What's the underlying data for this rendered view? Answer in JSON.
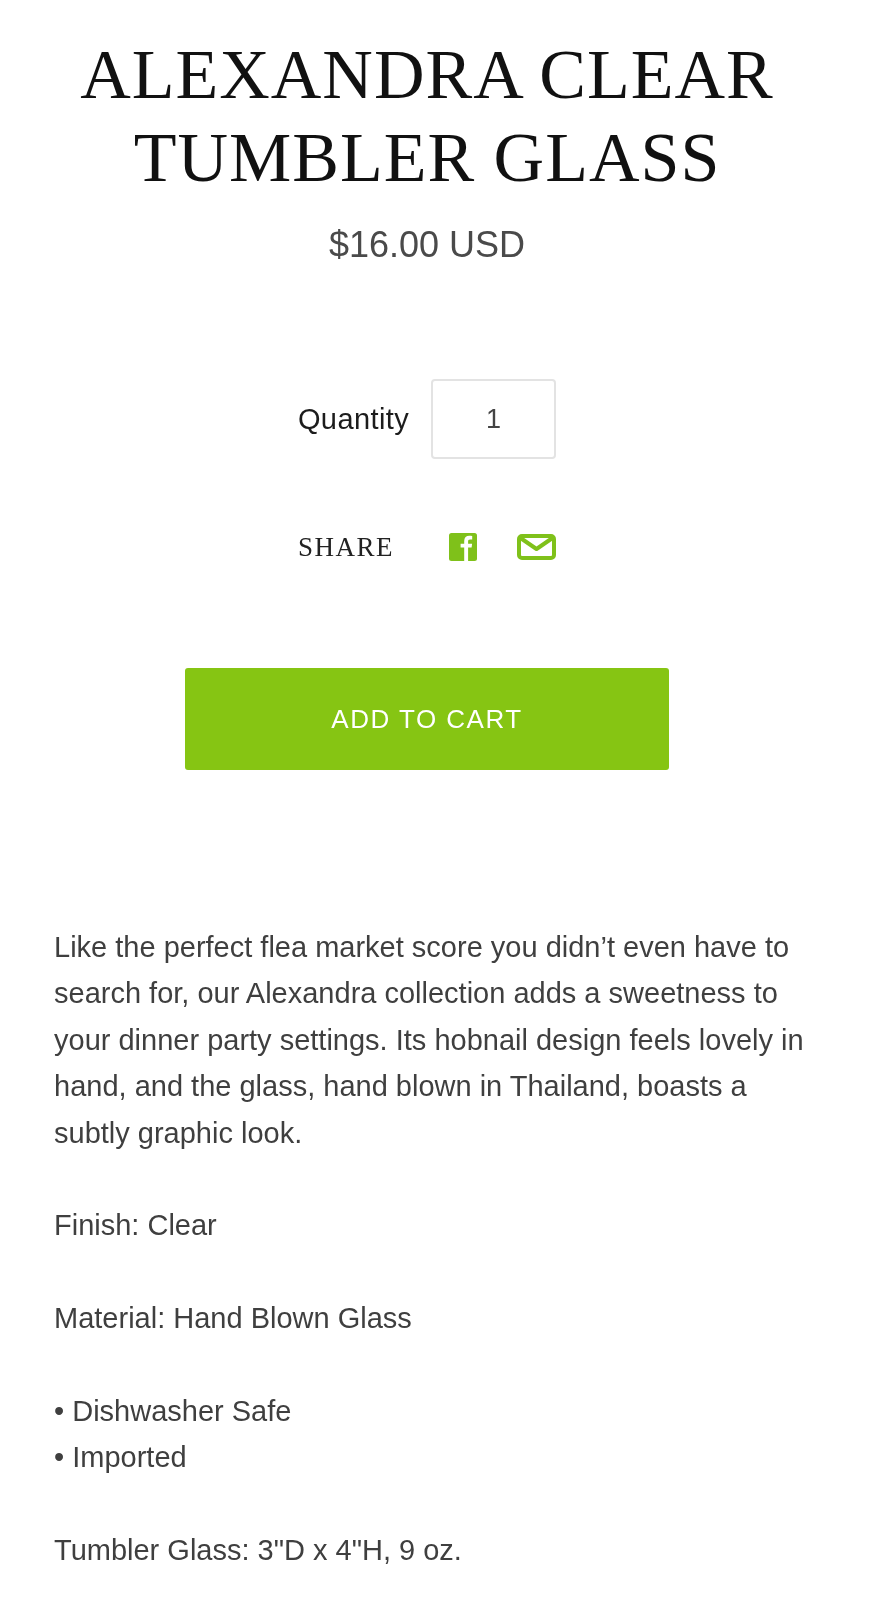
{
  "product": {
    "title": "ALEXANDRA CLEAR TUMBLER GLASS",
    "price": "$16.00 USD"
  },
  "quantity": {
    "label": "Quantity",
    "value": "1"
  },
  "share": {
    "label": "SHARE",
    "links": [
      {
        "kind": "facebook"
      },
      {
        "kind": "email"
      }
    ]
  },
  "add_to_cart": {
    "label": "ADD TO CART"
  },
  "description": [
    {
      "kind": "paragraph",
      "text": "Like the perfect flea market score you didn’t even have to search for, our Alexandra collection adds a sweetness to your dinner party settings. Its hobnail design feels lovely in hand, and the glass, hand blown in Thailand, boasts a subtly graphic look."
    },
    {
      "kind": "paragraph",
      "text": "Finish: Clear"
    },
    {
      "kind": "paragraph",
      "text": "Material: Hand Blown Glass"
    },
    {
      "kind": "list",
      "items": [
        "• Dishwasher Safe",
        "• Imported"
      ]
    },
    {
      "kind": "paragraph",
      "text": "Tumbler Glass: 3\"D x 4\"H, 9 oz."
    }
  ]
}
